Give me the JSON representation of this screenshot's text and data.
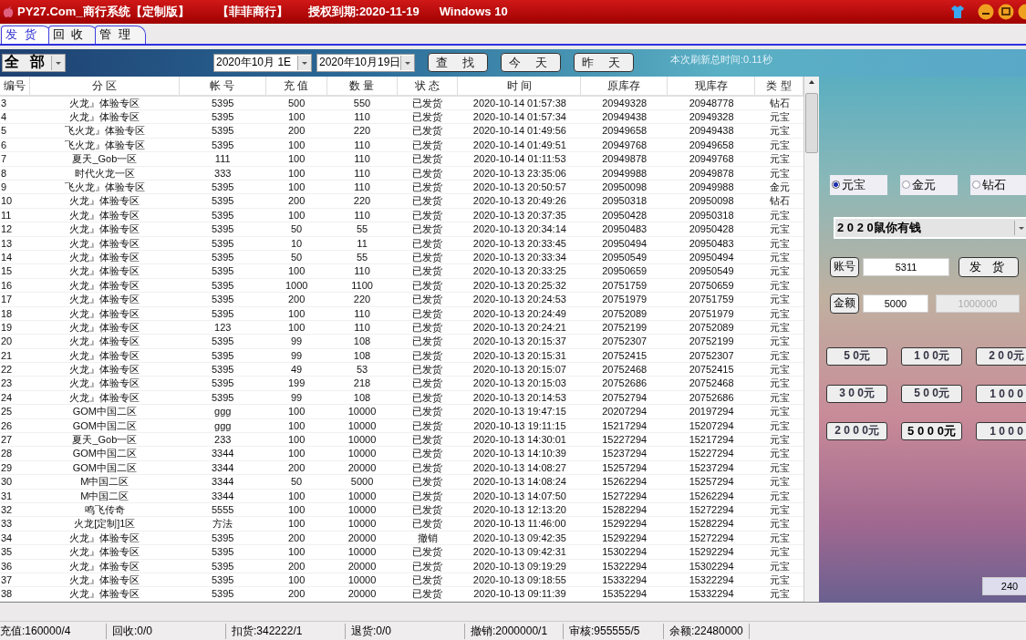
{
  "window": {
    "title": "PY27.Com_商行系统【定制版】",
    "shop": "【菲菲商行】",
    "license": "授权到期:2020-11-19",
    "os": "Windows 10"
  },
  "tabs": [
    {
      "label": "发 货",
      "selected": true
    },
    {
      "label": "回 收",
      "selected": false
    },
    {
      "label": "管 理",
      "selected": false
    }
  ],
  "toolbar": {
    "scope": "全 部",
    "date_from": "2020年10月 1E",
    "date_to": "2020年10月19日",
    "buttons": [
      "查 找",
      "今 天",
      "昨 天"
    ],
    "refresh_time": "本次刷新总时间:0.11秒"
  },
  "table": {
    "columns": [
      "编号",
      "分 区",
      "帐 号",
      "充 值",
      "数 量",
      "状 态",
      "时 间",
      "原库存",
      "现库存",
      "类 型"
    ],
    "rows": [
      [
        "3",
        "火龙』体验专区",
        "5395",
        "500",
        "550",
        "已发货",
        "2020-10-14 01:57:38",
        "20949328",
        "20948778",
        "钻石"
      ],
      [
        "4",
        "火龙』体验专区",
        "5395",
        "100",
        "110",
        "已发货",
        "2020-10-14 01:57:34",
        "20949438",
        "20949328",
        "元宝"
      ],
      [
        "5",
        "飞火龙』体验专区",
        "5395",
        "200",
        "220",
        "已发货",
        "2020-10-14 01:49:56",
        "20949658",
        "20949438",
        "元宝"
      ],
      [
        "6",
        "飞火龙』体验专区",
        "5395",
        "100",
        "110",
        "已发货",
        "2020-10-14 01:49:51",
        "20949768",
        "20949658",
        "元宝"
      ],
      [
        "7",
        "夏天_Gob一区",
        "111",
        "100",
        "110",
        "已发货",
        "2020-10-14 01:11:53",
        "20949878",
        "20949768",
        "元宝"
      ],
      [
        "8",
        "时代火龙一区",
        "333",
        "100",
        "110",
        "已发货",
        "2020-10-13 23:35:06",
        "20949988",
        "20949878",
        "元宝"
      ],
      [
        "9",
        "飞火龙』体验专区",
        "5395",
        "100",
        "110",
        "已发货",
        "2020-10-13 20:50:57",
        "20950098",
        "20949988",
        "金元"
      ],
      [
        "10",
        "火龙』体验专区",
        "5395",
        "200",
        "220",
        "已发货",
        "2020-10-13 20:49:26",
        "20950318",
        "20950098",
        "钻石"
      ],
      [
        "11",
        "火龙』体验专区",
        "5395",
        "100",
        "110",
        "已发货",
        "2020-10-13 20:37:35",
        "20950428",
        "20950318",
        "元宝"
      ],
      [
        "12",
        "火龙』体验专区",
        "5395",
        "50",
        "55",
        "已发货",
        "2020-10-13 20:34:14",
        "20950483",
        "20950428",
        "元宝"
      ],
      [
        "13",
        "火龙』体验专区",
        "5395",
        "10",
        "11",
        "已发货",
        "2020-10-13 20:33:45",
        "20950494",
        "20950483",
        "元宝"
      ],
      [
        "14",
        "火龙』体验专区",
        "5395",
        "50",
        "55",
        "已发货",
        "2020-10-13 20:33:34",
        "20950549",
        "20950494",
        "元宝"
      ],
      [
        "15",
        "火龙』体验专区",
        "5395",
        "100",
        "110",
        "已发货",
        "2020-10-13 20:33:25",
        "20950659",
        "20950549",
        "元宝"
      ],
      [
        "16",
        "火龙』体验专区",
        "5395",
        "1000",
        "1100",
        "已发货",
        "2020-10-13 20:25:32",
        "20751759",
        "20750659",
        "元宝"
      ],
      [
        "17",
        "火龙』体验专区",
        "5395",
        "200",
        "220",
        "已发货",
        "2020-10-13 20:24:53",
        "20751979",
        "20751759",
        "元宝"
      ],
      [
        "18",
        "火龙』体验专区",
        "5395",
        "100",
        "110",
        "已发货",
        "2020-10-13 20:24:49",
        "20752089",
        "20751979",
        "元宝"
      ],
      [
        "19",
        "火龙』体验专区",
        "123",
        "100",
        "110",
        "已发货",
        "2020-10-13 20:24:21",
        "20752199",
        "20752089",
        "元宝"
      ],
      [
        "20",
        "火龙』体验专区",
        "5395",
        "99",
        "108",
        "已发货",
        "2020-10-13 20:15:37",
        "20752307",
        "20752199",
        "元宝"
      ],
      [
        "21",
        "火龙』体验专区",
        "5395",
        "99",
        "108",
        "已发货",
        "2020-10-13 20:15:31",
        "20752415",
        "20752307",
        "元宝"
      ],
      [
        "22",
        "火龙』体验专区",
        "5395",
        "49",
        "53",
        "已发货",
        "2020-10-13 20:15:07",
        "20752468",
        "20752415",
        "元宝"
      ],
      [
        "23",
        "火龙』体验专区",
        "5395",
        "199",
        "218",
        "已发货",
        "2020-10-13 20:15:03",
        "20752686",
        "20752468",
        "元宝"
      ],
      [
        "24",
        "火龙』体验专区",
        "5395",
        "99",
        "108",
        "已发货",
        "2020-10-13 20:14:53",
        "20752794",
        "20752686",
        "元宝"
      ],
      [
        "25",
        "GOM中国二区",
        "ggg",
        "100",
        "10000",
        "已发货",
        "2020-10-13 19:47:15",
        "20207294",
        "20197294",
        "元宝"
      ],
      [
        "26",
        "GOM中国二区",
        "ggg",
        "100",
        "10000",
        "已发货",
        "2020-10-13 19:11:15",
        "15217294",
        "15207294",
        "元宝"
      ],
      [
        "27",
        "夏天_Gob一区",
        "233",
        "100",
        "10000",
        "已发货",
        "2020-10-13 14:30:01",
        "15227294",
        "15217294",
        "元宝"
      ],
      [
        "28",
        "GOM中国二区",
        "3344",
        "100",
        "10000",
        "已发货",
        "2020-10-13 14:10:39",
        "15237294",
        "15227294",
        "元宝"
      ],
      [
        "29",
        "GOM中国二区",
        "3344",
        "200",
        "20000",
        "已发货",
        "2020-10-13 14:08:27",
        "15257294",
        "15237294",
        "元宝"
      ],
      [
        "30",
        "M中国二区",
        "3344",
        "50",
        "5000",
        "已发货",
        "2020-10-13 14:08:24",
        "15262294",
        "15257294",
        "元宝"
      ],
      [
        "31",
        "M中国二区",
        "3344",
        "100",
        "10000",
        "已发货",
        "2020-10-13 14:07:50",
        "15272294",
        "15262294",
        "元宝"
      ],
      [
        "32",
        "鸣飞传奇",
        "5555",
        "100",
        "10000",
        "已发货",
        "2020-10-13 12:13:20",
        "15282294",
        "15272294",
        "元宝"
      ],
      [
        "33",
        "火龙[定制]1区",
        "方法",
        "100",
        "10000",
        "已发货",
        "2020-10-13 11:46:00",
        "15292294",
        "15282294",
        "元宝"
      ],
      [
        "34",
        "火龙』体验专区",
        "5395",
        "200",
        "20000",
        "撤销",
        "2020-10-13 09:42:35",
        "15292294",
        "15272294",
        "元宝"
      ],
      [
        "35",
        "火龙』体验专区",
        "5395",
        "100",
        "10000",
        "已发货",
        "2020-10-13 09:42:31",
        "15302294",
        "15292294",
        "元宝"
      ],
      [
        "36",
        "火龙』体验专区",
        "5395",
        "200",
        "20000",
        "已发货",
        "2020-10-13 09:19:29",
        "15322294",
        "15302294",
        "元宝"
      ],
      [
        "37",
        "火龙』体验专区",
        "5395",
        "100",
        "10000",
        "已发货",
        "2020-10-13 09:18:55",
        "15332294",
        "15322294",
        "元宝"
      ],
      [
        "38",
        "火龙』体验专区",
        "5395",
        "200",
        "20000",
        "已发货",
        "2020-10-13 09:11:39",
        "15352294",
        "15332294",
        "元宝"
      ]
    ]
  },
  "currency": [
    {
      "label": "元宝",
      "selected": true
    },
    {
      "label": "金元",
      "selected": false
    },
    {
      "label": "钻石",
      "selected": false
    }
  ],
  "package": "2 0 2 0鼠你有钱",
  "account": {
    "label": "账号",
    "value": "5311",
    "send": "发 货"
  },
  "amount": {
    "label": "金额",
    "value": "5000",
    "limit": "1000000",
    "limit_disabled": true
  },
  "presets": [
    {
      "label": "5 0元",
      "selected": false
    },
    {
      "label": "1 0 0元",
      "selected": false
    },
    {
      "label": "2 0 0元",
      "selected": false
    },
    {
      "label": "3 0 0元",
      "selected": false
    },
    {
      "label": "5 0 0元",
      "selected": false
    },
    {
      "label": "1 0 0 0",
      "selected": false
    },
    {
      "label": "2 0 0 0元",
      "selected": false
    },
    {
      "label": "5 0 0 0元",
      "selected": true
    },
    {
      "label": "1 0 0 0",
      "selected": false
    }
  ],
  "extra_field": "240",
  "status_bar": [
    "充值:160000/4",
    "回收:0/0",
    "扣货:342222/1",
    "退货:0/0",
    "撤销:2000000/1",
    "审核:955555/5",
    "余额:22480000"
  ]
}
